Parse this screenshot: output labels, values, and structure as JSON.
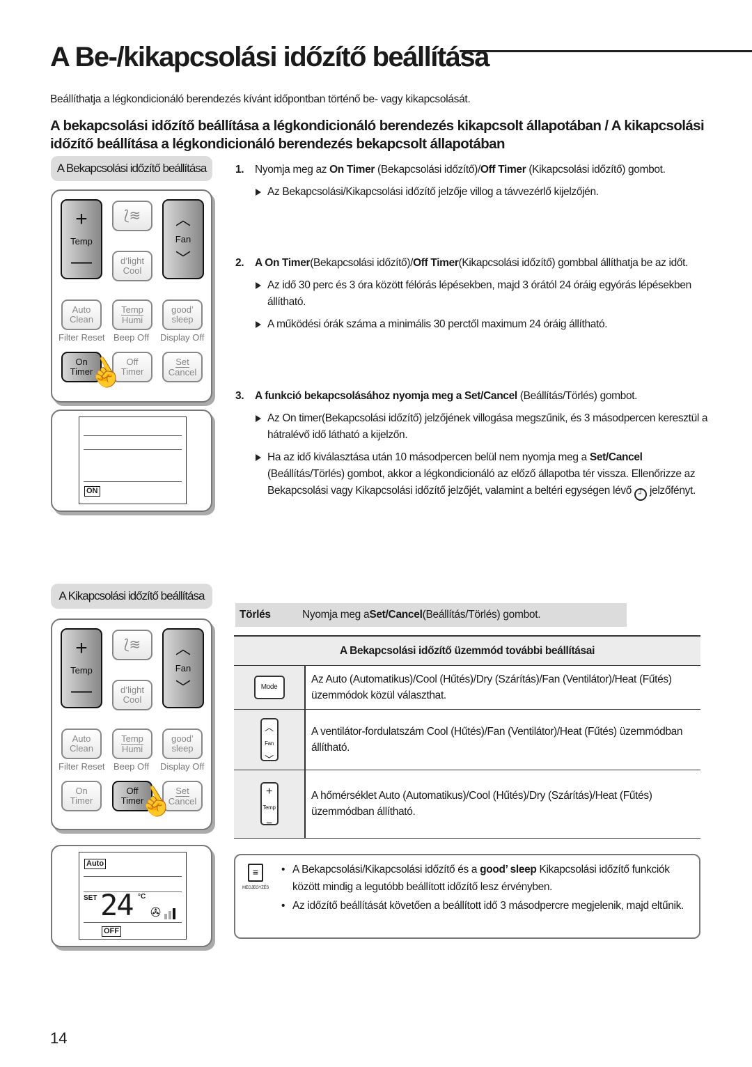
{
  "title": "A Be-/kikapcsolási időzítő beállítása",
  "intro": "Beállíthatja a légkondicionáló berendezés kívánt időpontban történő be- vagy kikapcsolását.",
  "subhead": "A bekapcsolási időzítő beállítása a légkondicionáló berendezés kikapcsolt állapotában / A kikapcsolási időzítő beállítása a légkondicionáló berendezés bekapcsolt állapotában",
  "on_section": {
    "label": "A Bekapcsolási időzítő beállítása"
  },
  "off_section": {
    "label": "A Kikapcsolási időzítő beállítása"
  },
  "remote": {
    "temp": "Temp",
    "fan": "Fan",
    "dlight": "d’light",
    "cool": "Cool",
    "auto": "Auto",
    "clean": "Clean",
    "temp2": "Temp",
    "humi": "Humi",
    "good": "good’",
    "sleep": "sleep",
    "filter_reset": "Filter Reset",
    "beep_off": "Beep Off",
    "display_off": "Display Off",
    "on": "On",
    "off": "Off",
    "timer": "Timer",
    "set": "Set",
    "cancel": "Cancel"
  },
  "display1": {
    "indicator": "ON"
  },
  "display2": {
    "mode": "Auto",
    "set": "SET",
    "temp": "24",
    "unit": "°C",
    "indicator": "OFF",
    "fan_level": 2
  },
  "steps": [
    {
      "num": "1.",
      "parts": [
        "Nyomja meg az ",
        "On Timer",
        " (Bekapcsolási időzítő)/",
        "Off Timer",
        " (Kikapcsolási időzítő) gombot."
      ],
      "bullets": [
        "Az Bekapcsolási/Kikapcsolási időzítő jelzője villog a távvezérlő kijelzőjén."
      ]
    },
    {
      "num": "2.",
      "parts": [
        "A ",
        "On Timer",
        "(Bekapcsolási időzítő)/",
        "Off Timer",
        "(Kikapcsolási időzítő) gombbal állíthatja be az időt."
      ],
      "bullets": [
        "Az idő 30 perc és 3 óra között félórás lépésekben, majd 3 órától 24 óráig egyórás lépésekben állítható.",
        "A működési órák száma a minimális 30 perctől maximum 24 óráig állítható."
      ]
    },
    {
      "num": "3.",
      "parts": [
        "A funkció bekapcsolásához nyomja meg a ",
        "Set/Cancel",
        " (Beállítás/Törlés) gombot."
      ],
      "bullets": [
        "Az On timer(Bekapcsolási időzítő) jelzőjének villogása megszűnik, és 3 másodpercen keresztül a hátralévő idő látható a kijelzőn."
      ],
      "bullet2": {
        "a": "Ha az idő kiválasztása után 10 másodpercen belül nem nyomja meg a ",
        "b": "Set/Cancel",
        "c": " (Beállítás/Törlés) gombot, akkor a légkondicionáló az előző állapotba tér vissza. Ellenőrizze az Bekapcsolási vagy Kikapcsolási időzítő jelzőjét, valamint a beltéri egységen lévő ",
        "d": " jelzőfényt."
      }
    }
  ],
  "torles": {
    "label": "Törlés",
    "a": "Nyomja meg a ",
    "b": "Set/Cancel",
    "c": "(Beállítás/Törlés) gombot."
  },
  "table": {
    "header": "A Bekapcsolási időzítő üzemmód további beállításai",
    "rows": [
      {
        "button": "Mode",
        "text": "Az Auto (Automatikus)/Cool (Hűtés)/Dry (Szárítás)/Fan (Ventilátor)/Heat (Fűtés) üzemmódok közül választhat."
      },
      {
        "button": "Fan",
        "text": "A ventilátor-fordulatszám Cool (Hűtés)/Fan (Ventilátor)/Heat (Fűtés) üzemmódban állítható."
      },
      {
        "button": "Temp",
        "text": "A hőmérséklet Auto (Automatikus)/Cool (Hűtés)/Dry (Szárítás)/Heat (Fűtés) üzemmódban állítható."
      }
    ]
  },
  "note": {
    "icon_label": "MEGJEGYZÉS",
    "items": [
      {
        "a": "A Bekapcsolási/Kikapcsolási időzítő és a ",
        "b": "good’ sleep",
        "c": " Kikapcsolási időzítő funkciók között mindig a legutóbb beállított időzítő lesz érvényben."
      },
      {
        "a": "Az időzítő beállítását követően a beállított idő 3 másodpercre megjelenik, majd eltűnik."
      }
    ]
  },
  "page_number": "14"
}
